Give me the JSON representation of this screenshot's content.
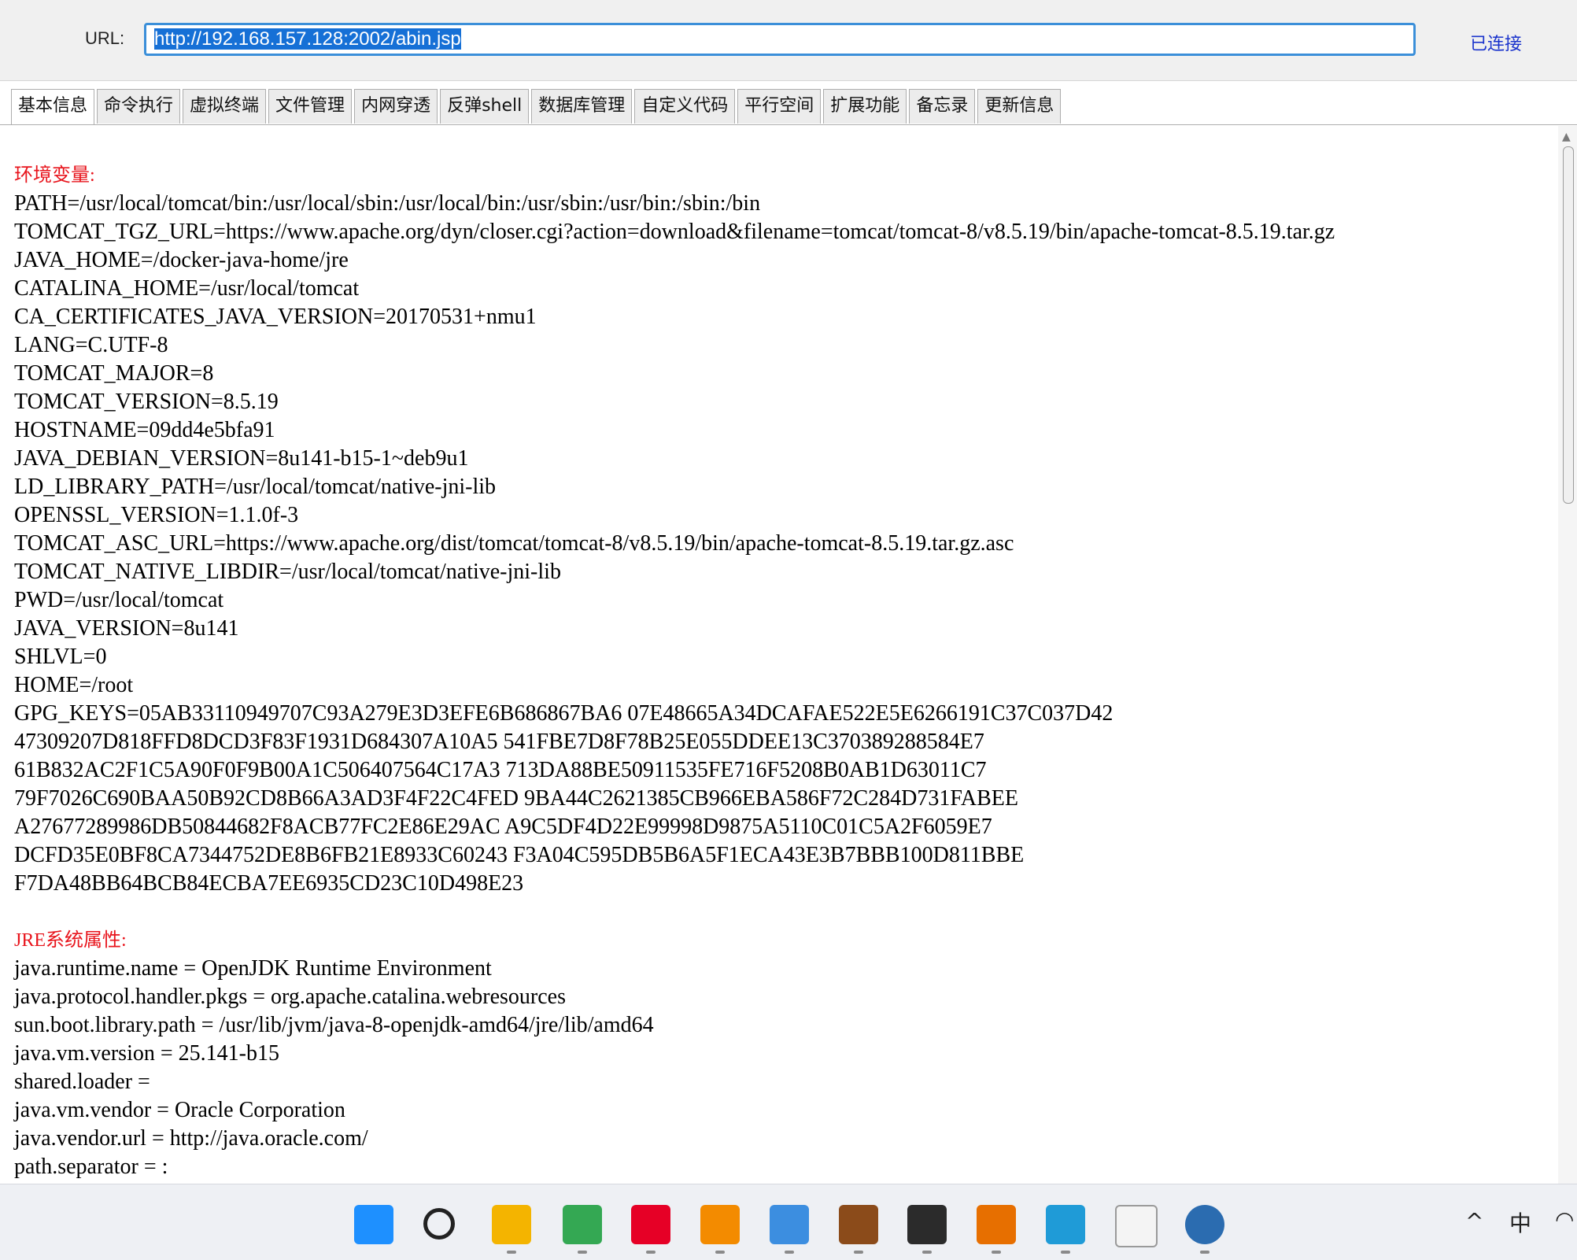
{
  "toolbar": {
    "url_label": "URL:",
    "url_value": "http://192.168.157.128:2002/abin.jsp",
    "status": "已连接"
  },
  "tabs": [
    {
      "label": "基本信息",
      "active": true
    },
    {
      "label": "命令执行",
      "active": false
    },
    {
      "label": "虚拟终端",
      "active": false
    },
    {
      "label": "文件管理",
      "active": false
    },
    {
      "label": "内网穿透",
      "active": false
    },
    {
      "label": "反弹shell",
      "active": false
    },
    {
      "label": "数据库管理",
      "active": false
    },
    {
      "label": "自定义代码",
      "active": false
    },
    {
      "label": "平行空间",
      "active": false
    },
    {
      "label": "扩展功能",
      "active": false
    },
    {
      "label": "备忘录",
      "active": false
    },
    {
      "label": "更新信息",
      "active": false
    }
  ],
  "content": {
    "env_title": "环境变量:",
    "env_lines": [
      "PATH=/usr/local/tomcat/bin:/usr/local/sbin:/usr/local/bin:/usr/sbin:/usr/bin:/sbin:/bin",
      "TOMCAT_TGZ_URL=https://www.apache.org/dyn/closer.cgi?action=download&filename=tomcat/tomcat-8/v8.5.19/bin/apache-tomcat-8.5.19.tar.gz",
      "JAVA_HOME=/docker-java-home/jre",
      "CATALINA_HOME=/usr/local/tomcat",
      "CA_CERTIFICATES_JAVA_VERSION=20170531+nmu1",
      "LANG=C.UTF-8",
      "TOMCAT_MAJOR=8",
      "TOMCAT_VERSION=8.5.19",
      "HOSTNAME=09dd4e5bfa91",
      "JAVA_DEBIAN_VERSION=8u141-b15-1~deb9u1",
      "LD_LIBRARY_PATH=/usr/local/tomcat/native-jni-lib",
      "OPENSSL_VERSION=1.1.0f-3",
      "TOMCAT_ASC_URL=https://www.apache.org/dist/tomcat/tomcat-8/v8.5.19/bin/apache-tomcat-8.5.19.tar.gz.asc",
      "TOMCAT_NATIVE_LIBDIR=/usr/local/tomcat/native-jni-lib",
      "PWD=/usr/local/tomcat",
      "JAVA_VERSION=8u141",
      "SHLVL=0",
      "HOME=/root",
      "GPG_KEYS=05AB33110949707C93A279E3D3EFE6B686867BA6 07E48665A34DCAFAE522E5E6266191C37C037D42",
      "47309207D818FFD8DCD3F83F1931D684307A10A5 541FBE7D8F78B25E055DDEE13C370389288584E7",
      "61B832AC2F1C5A90F0F9B00A1C506407564C17A3 713DA88BE50911535FE716F5208B0AB1D63011C7",
      "79F7026C690BAA50B92CD8B66A3AD3F4F22C4FED 9BA44C2621385CB966EBA586F72C284D731FABEE",
      "A27677289986DB50844682F8ACB77FC2E86E29AC A9C5DF4D22E99998D9875A5110C01C5A2F6059E7",
      "DCFD35E0BF8CA7344752DE8B6FB21E8933C60243 F3A04C595DB5B6A5F1ECA43E3B7BBB100D811BBE",
      "F7DA48BB64BCB84ECBA7EE6935CD23C10D498E23"
    ],
    "jre_title": "JRE系统属性:",
    "jre_lines": [
      "java.runtime.name = OpenJDK Runtime Environment",
      "java.protocol.handler.pkgs = org.apache.catalina.webresources",
      "sun.boot.library.path = /usr/lib/jvm/java-8-openjdk-amd64/jre/lib/amd64",
      "java.vm.version = 25.141-b15",
      "shared.loader =",
      "java.vm.vendor = Oracle Corporation",
      "java.vendor.url = http://java.oracle.com/",
      "path.separator = :"
    ]
  },
  "taskbar": {
    "icons": [
      {
        "name": "windows-start-icon",
        "color": "#1e90ff"
      },
      {
        "name": "search-icon",
        "color": "#222222"
      },
      {
        "name": "file-explorer-icon",
        "color": "#f4b400"
      },
      {
        "name": "chrome-icon",
        "color": "#34a853"
      },
      {
        "name": "netease-music-icon",
        "color": "#e60026"
      },
      {
        "name": "vmware-icon",
        "color": "#f38b00"
      },
      {
        "name": "notes-app-icon",
        "color": "#3c8ee0"
      },
      {
        "name": "game-app-icon",
        "color": "#8b4b1a"
      },
      {
        "name": "terminal-icon",
        "color": "#2b2b2b"
      },
      {
        "name": "java-icon",
        "color": "#e76f00"
      },
      {
        "name": "notepad-icon",
        "color": "#1f9bd7"
      },
      {
        "name": "blank-file-icon",
        "color": "#f4f4f4"
      },
      {
        "name": "scorpion-tool-icon",
        "color": "#2b6cb0"
      }
    ],
    "tray_ime": "中"
  }
}
